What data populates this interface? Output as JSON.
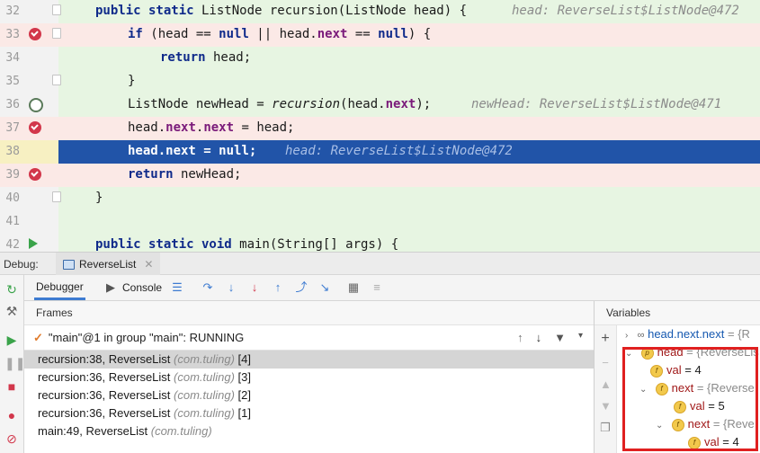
{
  "editor": {
    "lines": [
      {
        "num": "32",
        "bg": "green",
        "gutter": "fold"
      },
      {
        "num": "33",
        "bg": "pink",
        "gutter": "bp"
      },
      {
        "num": "34",
        "bg": "green",
        "gutter": ""
      },
      {
        "num": "35",
        "bg": "green",
        "gutter": "fold"
      },
      {
        "num": "36",
        "bg": "green",
        "gutter": "bp-off"
      },
      {
        "num": "37",
        "bg": "pink",
        "gutter": "bp"
      },
      {
        "num": "38",
        "bg": "sel",
        "gutter": ""
      },
      {
        "num": "39",
        "bg": "pink",
        "gutter": "bp"
      },
      {
        "num": "40",
        "bg": "green",
        "gutter": "fold"
      },
      {
        "num": "41",
        "bg": "green",
        "gutter": ""
      },
      {
        "num": "42",
        "bg": "green",
        "gutter": "run"
      }
    ],
    "code": {
      "l32_kw": "public static",
      "l32_rest": " ListNode recursion(ListNode head) {",
      "l32_hint": "head: ReverseList$ListNode@472",
      "l33_if": "if",
      "l33_a": " (head == ",
      "l33_null1": "null",
      "l33_b": " || head.",
      "l33_next": "next",
      "l33_c": " == ",
      "l33_null2": "null",
      "l33_d": ") {",
      "l34_ret": "return",
      "l34_rest": " head;",
      "l35": "}",
      "l36_a": "ListNode newHead = ",
      "l36_call": "recursion",
      "l36_b": "(head.",
      "l36_next": "next",
      "l36_c": ");",
      "l36_hint": "newHead: ReverseList$ListNode@471",
      "l37_a": "head.",
      "l37_next1": "next",
      "l37_dot": ".",
      "l37_next2": "next",
      "l37_b": " = head;",
      "l38_a": "head.next = ",
      "l38_null": "null",
      "l38_b": ";",
      "l38_hint": "head: ReverseList$ListNode@472",
      "l39_ret": "return",
      "l39_rest": " newHead;",
      "l40": "}",
      "l42_kw": "public static void",
      "l42_rest": " main(String[] args) {"
    }
  },
  "debug": {
    "label": "Debug:",
    "tab": "ReverseList",
    "tabs": {
      "debugger": "Debugger",
      "console": "Console"
    }
  },
  "frames": {
    "header": "Frames",
    "thread": "\"main\"@1 in group \"main\": RUNNING",
    "rows": [
      {
        "name": "recursion:38, ReverseList ",
        "pkg": "(com.tuling)",
        "idx": " [4]"
      },
      {
        "name": "recursion:36, ReverseList ",
        "pkg": "(com.tuling)",
        "idx": " [3]"
      },
      {
        "name": "recursion:36, ReverseList ",
        "pkg": "(com.tuling)",
        "idx": " [2]"
      },
      {
        "name": "recursion:36, ReverseList ",
        "pkg": "(com.tuling)",
        "idx": " [1]"
      },
      {
        "name": "main:49, ReverseList ",
        "pkg": "(com.tuling)",
        "idx": ""
      }
    ]
  },
  "variables": {
    "header": "Variables",
    "watch": {
      "name": "head.next.next",
      "rest": " = {R"
    },
    "head": {
      "name": "head",
      "rest": " = {ReverseLis"
    },
    "head_val": {
      "name": "val",
      "rest": " = 4"
    },
    "next1": {
      "name": "next",
      "rest": " = {Reverse"
    },
    "next1_val": {
      "name": "val",
      "rest": " = 5"
    },
    "next2": {
      "name": "next",
      "rest": " = {Reve"
    },
    "next2_val": {
      "name": "val",
      "rest": " = 4"
    }
  },
  "colors": {
    "accent": "#2154a8",
    "highlight_box": "#e02020",
    "breakpoint": "#d2374b"
  }
}
